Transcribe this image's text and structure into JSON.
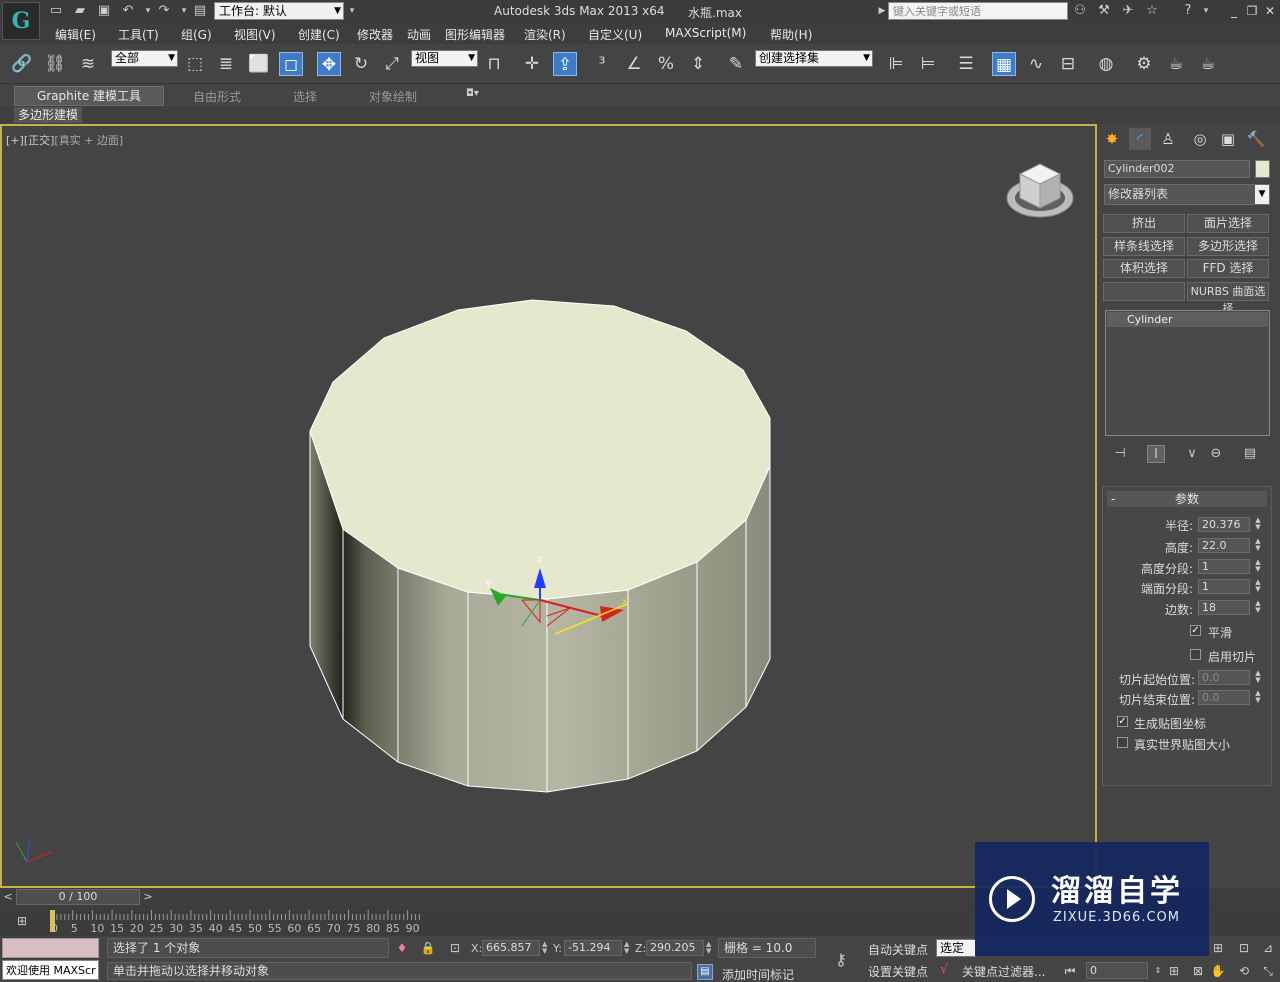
{
  "titlebar": {
    "workspace": "工作台: 默认",
    "app_title": "Autodesk 3ds Max  2013 x64",
    "file_title": "水瓶.max",
    "search_placeholder": "键入关键字或短语"
  },
  "menu": [
    "编辑(E)",
    "工具(T)",
    "组(G)",
    "视图(V)",
    "创建(C)",
    "修改器",
    "动画",
    "图形编辑器",
    "渲染(R)",
    "自定义(U)",
    "MAXScript(M)",
    "帮助(H)"
  ],
  "toolbar": {
    "selection_filter": "全部",
    "ref_coord": "视图",
    "named_selection": "创建选择集"
  },
  "ribbon": {
    "tabs": [
      "Graphite 建模工具",
      "自由形式",
      "选择",
      "对象绘制"
    ],
    "sub_label": "多边形建模"
  },
  "viewport": {
    "label_plus": "[+]",
    "label_view": "[正交]",
    "label_shading": "[真实 + 边面]",
    "gizmo_x": "x",
    "gizmo_y": "y",
    "gizmo_z": "z",
    "object_color": "#e6e8cd",
    "border_color": "#c8b148"
  },
  "command_panel": {
    "object_name": "Cylinder002",
    "object_color": "#e6e8cd",
    "modifier_list": "修改器列表",
    "modifier_buttons": [
      "挤出",
      "面片选择",
      "样条线选择",
      "多边形选择",
      "体积选择",
      "FFD 选择",
      "",
      "NURBS 曲面选择"
    ],
    "stack_item": "Cylinder",
    "rollout_title": "参数",
    "rollout_collapse": "-",
    "params": {
      "radius_label": "半径:",
      "radius": "20.376",
      "height_label": "高度:",
      "height": "22.0",
      "height_segs_label": "高度分段:",
      "height_segs": "1",
      "cap_segs_label": "端面分段:",
      "cap_segs": "1",
      "sides_label": "边数:",
      "sides": "18",
      "smooth_label": "平滑",
      "smooth": true,
      "slice_on_label": "启用切片",
      "slice_on": false,
      "slice_from_label": "切片起始位置:",
      "slice_from": "0.0",
      "slice_to_label": "切片结束位置:",
      "slice_to": "0.0",
      "gen_map_label": "生成贴图坐标",
      "gen_map": true,
      "real_world_label": "真实世界贴图大小",
      "real_world": false
    }
  },
  "timeline": {
    "frame_display": "0 / 100",
    "ticks": [
      "0",
      "5",
      "10",
      "15",
      "20",
      "25",
      "30",
      "35",
      "40",
      "45",
      "50",
      "55",
      "60",
      "65",
      "70",
      "75",
      "80",
      "85",
      "90"
    ]
  },
  "status": {
    "welcome": "欢迎使用 MAXScr",
    "selected": "选择了 1 个对象",
    "prompt": "单击并拖动以选择并移动对象",
    "x_label": "X:",
    "x": "665.857",
    "y_label": "Y:",
    "y": "-51.294",
    "z_label": "Z:",
    "z": "290.205",
    "grid": "栅格 = 10.0",
    "add_time_tag": "添加时间标记",
    "auto_key": "自动关键点",
    "set_key": "设置关键点",
    "sel_filter": "选定对",
    "key_filters": "关键点过滤器...",
    "frame": "0"
  },
  "watermark": {
    "title": "溜溜自学",
    "url": "ZIXUE.3D66.COM"
  }
}
